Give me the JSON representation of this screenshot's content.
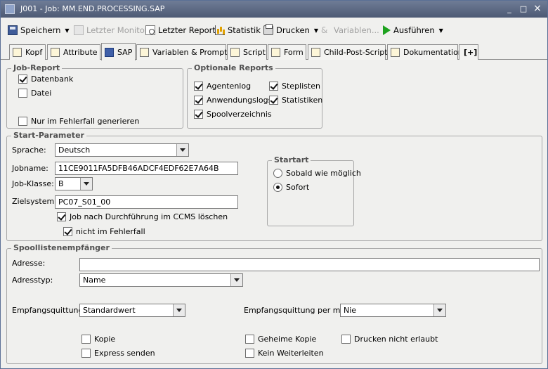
{
  "window": {
    "title": "J001 - Job: MM.END.PROCESSING.SAP",
    "minimize": "_",
    "maximize": "□",
    "close": "×"
  },
  "toolbar": {
    "save": "Speichern",
    "last_monitor": "Letzter Monitor",
    "last_report": "Letzter Report",
    "statistics": "Statistik",
    "print": "Drucken",
    "variables": "Variablen...",
    "execute": "Ausführen"
  },
  "tabs": [
    "Kopf",
    "Attribute",
    "SAP",
    "Variablen & Prompts",
    "Script",
    "Form",
    "Child-Post-Script",
    "Dokumentation",
    "[+]"
  ],
  "job_report": {
    "legend": "Job-Report",
    "database": "Datenbank",
    "file": "Datei",
    "only_on_error": "Nur im Fehlerfall generieren"
  },
  "optional_reports": {
    "legend": "Optionale Reports",
    "agent_log": "Agentenlog",
    "app_logs": "Anwendungslogs",
    "spool_dir": "Spoolverzeichnis",
    "step_lists": "Steplisten",
    "statistics": "Statistiken"
  },
  "start_params": {
    "legend": "Start-Parameter",
    "language_label": "Sprache:",
    "language_value": "Deutsch",
    "jobname_label": "Jobname:",
    "jobname_value": "11CE9011FA5DFB46ADCF4EDF62E7A64B",
    "jobclass_label": "Job-Klasse:",
    "jobclass_value": "B",
    "target_label": "Zielsystem:",
    "target_value": "PC07_S01_00",
    "delete_ccms": "Job nach Durchführung im CCMS löschen",
    "not_on_error": "nicht im Fehlerfall"
  },
  "start_type": {
    "legend": "Startart",
    "asap": "Sobald wie möglich",
    "immediate": "Sofort"
  },
  "spool_recipient": {
    "legend": "Spoollistenempfänger",
    "address_label": "Adresse:",
    "address_value": "",
    "address_type_label": "Adresstyp:",
    "address_type_value": "Name",
    "receipt_label": "Empfangsquittung:",
    "receipt_value": "Standardwert",
    "mail_receipt_label": "Empfangsquittung per mail:",
    "mail_receipt_value": "Nie",
    "copy": "Kopie",
    "express": "Express senden",
    "secret_copy": "Geheime Kopie",
    "no_forward": "Kein Weiterleiten",
    "print_not_allowed": "Drucken nicht erlaubt"
  }
}
